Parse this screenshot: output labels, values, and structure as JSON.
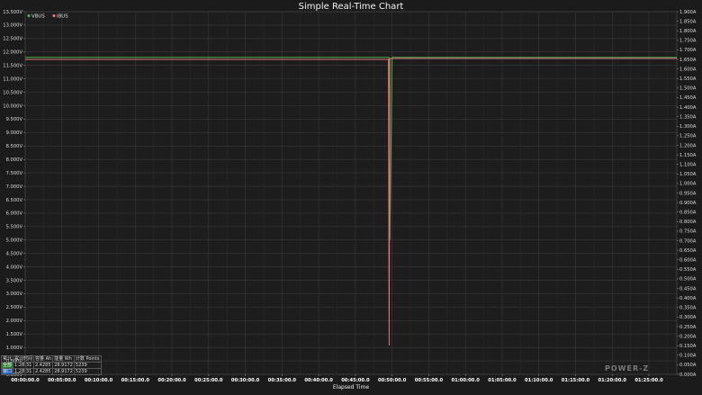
{
  "chart_data": {
    "type": "line",
    "title": "Simple Real-Time Chart",
    "xlabel": "Elapsed Time",
    "x_ticks": [
      "00:00:00.0",
      "00:05:00.0",
      "00:10:00.0",
      "00:15:00.0",
      "00:20:00.0",
      "00:25:00.0",
      "00:30:00.0",
      "00:35:00.0",
      "00:40:00.0",
      "00:45:00.0",
      "00:50:00.0",
      "00:55:00.0",
      "01:00:00.0",
      "01:05:00.0",
      "01:10:00.0",
      "01:15:00.0",
      "01:20:00.0",
      "01:25:00.0"
    ],
    "x_minutes": [
      0,
      5,
      10,
      15,
      20,
      25,
      30,
      35,
      40,
      45,
      50,
      55,
      60,
      65,
      70,
      75,
      80,
      85
    ],
    "xlim": [
      0,
      88.8
    ],
    "y_left": {
      "ticks": [
        "0.000V",
        "0.500V",
        "1.000V",
        "1.500V",
        "2.000V",
        "2.500V",
        "3.000V",
        "3.500V",
        "4.000V",
        "4.500V",
        "5.000V",
        "5.500V",
        "6.000V",
        "6.500V",
        "7.000V",
        "7.500V",
        "8.000V",
        "8.500V",
        "9.000V",
        "9.500V",
        "10.000V",
        "10.500V",
        "11.000V",
        "11.500V",
        "12.000V",
        "12.500V",
        "13.000V",
        "13.500V"
      ],
      "ylim": [
        0,
        13.5
      ]
    },
    "y_right": {
      "ticks": [
        "0.000A",
        "0.050A",
        "0.100A",
        "0.150A",
        "0.200A",
        "0.250A",
        "0.300A",
        "0.350A",
        "0.400A",
        "0.450A",
        "0.500A",
        "0.550A",
        "0.600A",
        "0.650A",
        "0.700A",
        "0.750A",
        "0.800A",
        "0.850A",
        "0.900A",
        "0.950A",
        "1.000A",
        "1.050A",
        "1.100A",
        "1.150A",
        "1.200A",
        "1.250A",
        "1.300A",
        "1.350A",
        "1.400A",
        "1.450A",
        "1.500A",
        "1.550A",
        "1.600A",
        "1.650A",
        "1.700A",
        "1.750A",
        "1.800A",
        "1.850A",
        "1.900A"
      ],
      "ylim": [
        0,
        1.9
      ]
    },
    "legend_position": "top-left",
    "series": [
      {
        "name": "VBUS",
        "axis": "left",
        "color": "#4caf50",
        "points": [
          [
            0,
            11.8
          ],
          [
            49.6,
            11.8
          ],
          [
            49.7,
            5.0
          ],
          [
            50.0,
            11.8
          ],
          [
            88.8,
            11.8
          ]
        ]
      },
      {
        "name": "IBUS",
        "axis": "right",
        "color": "#e57373",
        "points": [
          [
            0,
            1.65
          ],
          [
            49.5,
            1.65
          ],
          [
            49.6,
            0.15
          ],
          [
            49.7,
            1.655
          ],
          [
            88.8,
            1.655
          ]
        ]
      }
    ]
  },
  "stats_table": {
    "header": [
      "累计",
      "累计时间",
      "容量 Ah",
      "能量 Wh",
      "计数 Points"
    ],
    "rows": [
      [
        "全部",
        "1:28:31",
        "2.4285",
        "28.9172",
        "5239"
      ],
      [
        "窗口",
        "1:28:31",
        "2.4285",
        "28.9172",
        "5239"
      ]
    ]
  },
  "logo_text": "POWER-Z"
}
